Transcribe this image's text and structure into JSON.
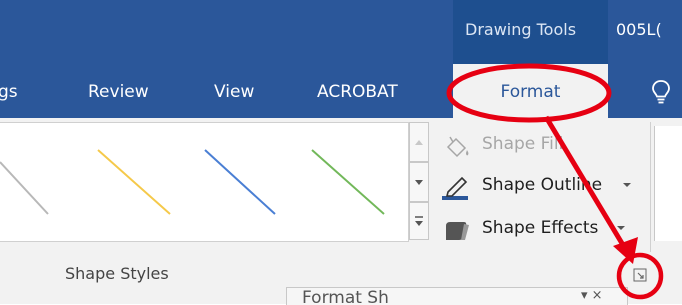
{
  "title_bar": {
    "contextual_label": "Drawing Tools",
    "document_name": "005L("
  },
  "tabs": [
    {
      "label": "gs"
    },
    {
      "label": "Review"
    },
    {
      "label": "View"
    },
    {
      "label": "ACROBAT"
    },
    {
      "label": "Format",
      "selected": true
    }
  ],
  "tell_me_icon": "lightbulb-icon",
  "ribbon": {
    "shape_styles": {
      "group_label": "Shape Styles",
      "gallery_line_colors": [
        "#b8b8b8",
        "#f5c94a",
        "#4a7fd4",
        "#72b85a"
      ]
    },
    "buttons": {
      "shape_fill": "Shape Fill",
      "shape_outline": "Shape Outline",
      "shape_effects": "Shape Effects"
    }
  },
  "format_pane": {
    "title": "Format Sh",
    "controls": "▾ ×"
  },
  "colors": {
    "ribbon_blue": "#2b579a",
    "annotation_red": "#e60012"
  }
}
